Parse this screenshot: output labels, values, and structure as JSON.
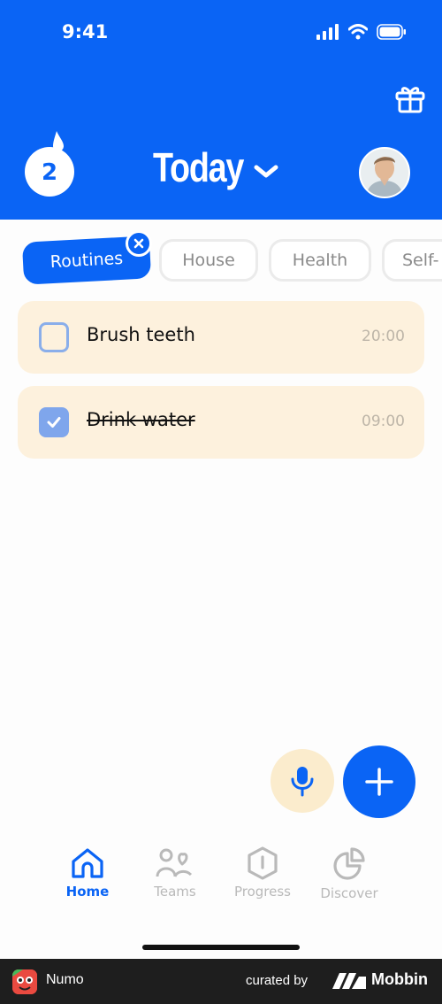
{
  "status_bar": {
    "time": "9:41"
  },
  "header": {
    "streak_count": "2",
    "title": "Today"
  },
  "chips": [
    {
      "label": "Routines",
      "active": true
    },
    {
      "label": "House",
      "active": false
    },
    {
      "label": "Health",
      "active": false
    },
    {
      "label": "Self-",
      "active": false
    }
  ],
  "tasks": [
    {
      "label": "Brush teeth",
      "time": "20:00",
      "done": false
    },
    {
      "label": "Drink water",
      "time": "09:00",
      "done": true
    }
  ],
  "nav": [
    {
      "label": "Home",
      "icon": "home-icon",
      "active": true
    },
    {
      "label": "Teams",
      "icon": "teams-icon",
      "active": false
    },
    {
      "label": "Progress",
      "icon": "progress-icon",
      "active": false
    },
    {
      "label": "Discover",
      "icon": "discover-icon",
      "active": false
    }
  ],
  "footer": {
    "app_name": "Numo",
    "curated_by": "curated by",
    "brand": "Mobbin"
  },
  "colors": {
    "primary": "#0a64f5",
    "task_bg": "#fdf1dd",
    "check": "#7fa6ec"
  }
}
